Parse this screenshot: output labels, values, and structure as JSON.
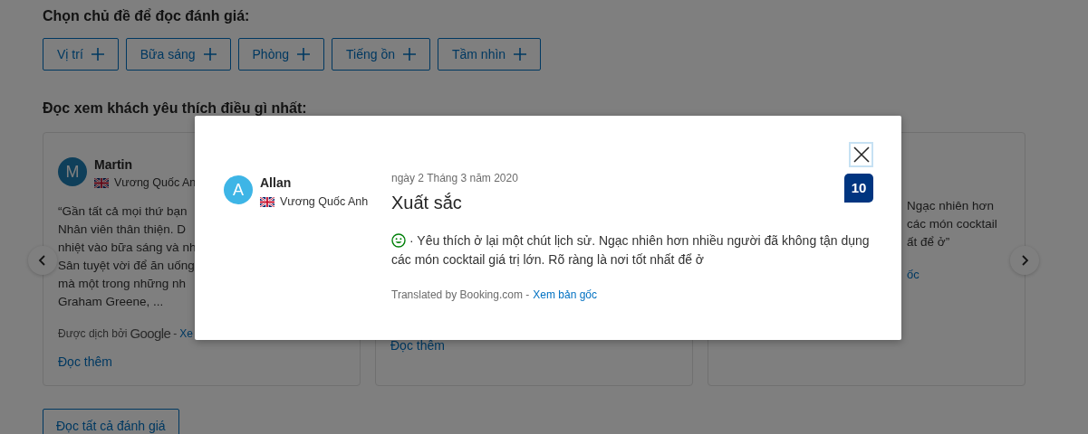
{
  "topics_heading": "Chọn chủ đề để đọc đánh giá:",
  "topics": [
    {
      "label": "Vị trí"
    },
    {
      "label": "Bữa sáng"
    },
    {
      "label": "Phòng"
    },
    {
      "label": "Tiếng ồn"
    },
    {
      "label": "Tầm nhìn"
    }
  ],
  "highlights_heading": "Đọc xem khách yêu thích điều gì nhất:",
  "reviews": [
    {
      "avatar_letter": "M",
      "name": "Martin",
      "country": "Vương Quốc An",
      "quote_lines": [
        "“Gần tất cả mọi thứ bạn",
        "Nhân viên thân thiện. D",
        "nhiệt vào bữa sáng và nh",
        "Sân tuyệt vời để ăn uống",
        "mà một trong những nh",
        "Graham Greene, ..."
      ],
      "translated_by": "Được dịch bởi",
      "translator": "Google",
      "separator": "-",
      "original_link": "Xe",
      "read_more": "Đọc thêm"
    },
    {
      "read_more": "Đọc thêm"
    },
    {
      "quote_lines": [
        "Ngạc nhiên hơn",
        "các món cocktail",
        "ất để ở”"
      ],
      "original_link": "ốc"
    }
  ],
  "read_all_button": "Đọc tất cả đánh giá",
  "modal": {
    "avatar_letter": "A",
    "name": "Allan",
    "country": "Vương Quốc Anh",
    "date": "ngày 2 Tháng 3 năm 2020",
    "title": "Xuất sắc",
    "score": "10",
    "text": "· Yêu thích ở lại một chút lịch sử. Ngạc nhiên hơn nhiều người đã không tận dụng các món cocktail giá trị lớn. Rõ ràng là nơi tốt nhất để ở",
    "translated_by": "Translated by Booking.com -",
    "original_link": "Xem bản gốc"
  }
}
